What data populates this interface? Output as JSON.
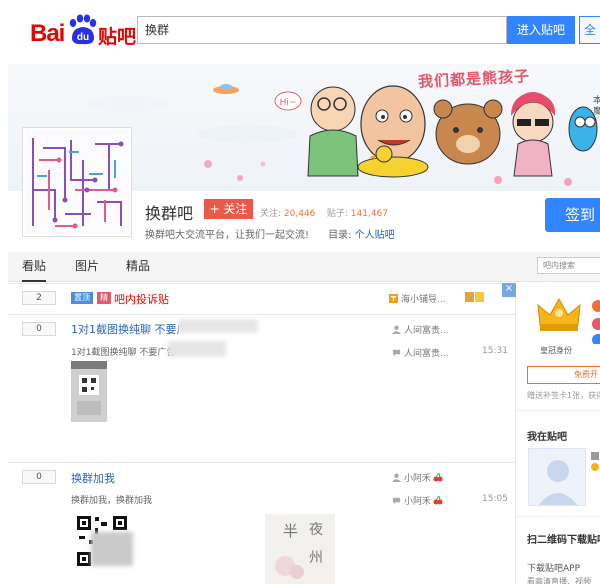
{
  "top": {
    "logo_bai": "Bai",
    "logo_du": "du",
    "logo_tieba": "贴吧",
    "search_value": "换群",
    "enter_button": "进入贴吧",
    "all_button": "全"
  },
  "banner": {
    "slogan": "我们都是熊孩子",
    "hi_text": "Hi~",
    "side_text_1": "本",
    "side_text_2": "魔"
  },
  "forum": {
    "name": "换群吧",
    "follow_label": "+ 关注",
    "follow_count_label": "关注:",
    "follow_count": "20,446",
    "post_count_label": "贴子:",
    "post_count": "141,467",
    "description": "换群吧大交流平台，让我们一起交流!",
    "directory_label": "目录:",
    "directory_link": "个人贴吧",
    "signin_label": "签到"
  },
  "tabs": [
    {
      "label": "看贴"
    },
    {
      "label": "图片"
    },
    {
      "label": "精品"
    }
  ],
  "inner_search_placeholder": "吧内搜索",
  "posts": [
    {
      "replies": "2",
      "badge_top": "置顶",
      "badge_fine": "精",
      "title": "吧内投诉贴",
      "author": "海小铺导...",
      "time": ""
    },
    {
      "replies": "0",
      "title": "1对1截图换纯聊 不要广",
      "abstract": "1对1截图换纯聊 不要广告",
      "author": "人间富贵...",
      "last_reply": "人间富贵...",
      "time": "15:31"
    },
    {
      "replies": "0",
      "title": "换群加我",
      "abstract": "换群加我，换群加我",
      "author": "小阿禾",
      "last_reply": "小阿禾",
      "time": "15:05"
    }
  ],
  "watermark": {
    "char1": "半",
    "char2": "夜",
    "char3": "州"
  },
  "sidebar": {
    "crown_label": "皇冠身份",
    "upgrade_label": "免费开",
    "note": "赠送补签卡1张，获得",
    "my_tieba_heading": "我在贴吧",
    "qr_heading": "扫二维码下载贴吧",
    "download_label": "下载贴吧APP",
    "download_sub": "看高清直播、视频"
  },
  "close_mark": "×",
  "colors": {
    "brand_red": "#e10602",
    "baidu_blue": "#3385ff",
    "link_blue": "#2d64b3",
    "follow_red": "#ea5a4a",
    "count_orange": "#f26f34"
  }
}
